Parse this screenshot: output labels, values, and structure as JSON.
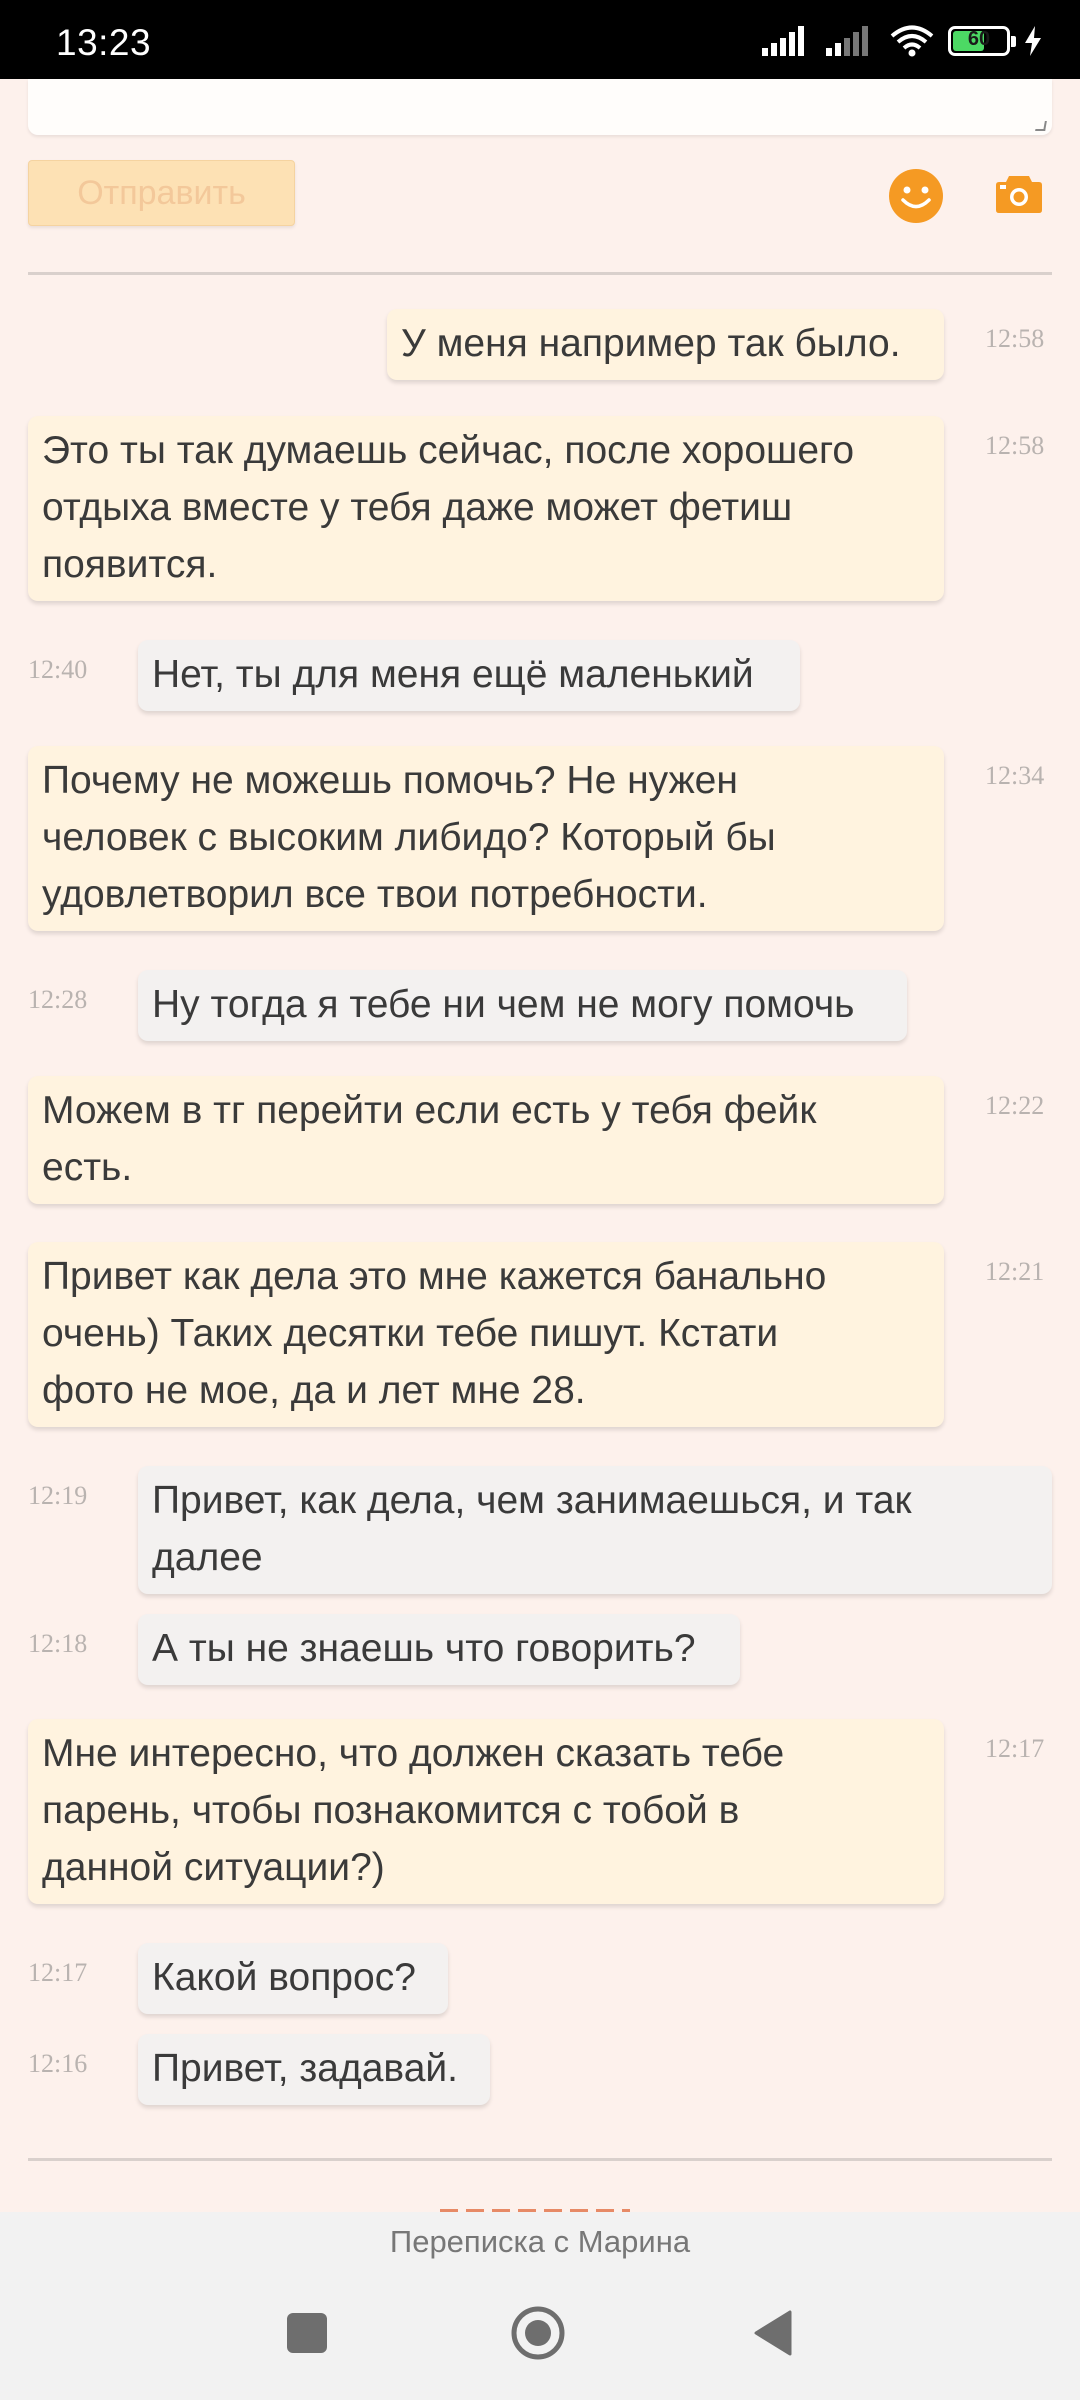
{
  "status_bar": {
    "time": "13:23",
    "battery": "60"
  },
  "compose": {
    "send_label": "Отправить",
    "emoji_icon": "smiley-icon",
    "photo_icon": "camera-icon"
  },
  "messages": [
    {
      "direction": "out",
      "text": "У меня например так было.",
      "time": "12:58"
    },
    {
      "direction": "out",
      "text": "Это ты так думаешь сейчас, после хорошего\nотдыха вместе у тебя даже может фетиш\nпоявится.",
      "time": "12:58"
    },
    {
      "direction": "in",
      "text": "Нет, ты для меня ещё маленький",
      "time": "12:40"
    },
    {
      "direction": "out",
      "text": "Почему не можешь помочь? Не нужен\nчеловек с высоким либидо? Который бы\nудовлетворил все твои потребности.",
      "time": "12:34"
    },
    {
      "direction": "in",
      "text": "Ну тогда я тебе ни чем не могу помочь",
      "time": "12:28"
    },
    {
      "direction": "out",
      "text": "Можем в тг перейти если есть у тебя фейк\nесть.",
      "time": "12:22"
    },
    {
      "direction": "out",
      "text": "Привет как дела это мне кажется банально\nочень) Таких десятки тебе пишут. Кстати\nфото не мое, да и лет мне 28.",
      "time": "12:21"
    },
    {
      "direction": "in",
      "text": "Привет, как дела, чем занимаешься, и так\nдалее",
      "time": "12:19"
    },
    {
      "direction": "in",
      "text": "А ты не знаешь что говорить?",
      "time": "12:18"
    },
    {
      "direction": "out",
      "text": "Мне интересно, что должен сказать тебе\nпарень, чтобы познакомится с тобой в\nданной ситуации?)",
      "time": "12:17"
    },
    {
      "direction": "in",
      "text": "Какой вопрос?",
      "time": "12:17"
    },
    {
      "direction": "in",
      "text": "Привет, задавай.",
      "time": "12:16"
    }
  ],
  "footer": {
    "title": "Переписка с Марина"
  },
  "nav": {
    "recents_icon": "square-icon",
    "home_icon": "circle-icon",
    "back_icon": "triangle-back-icon"
  },
  "colors": {
    "background": "#fdf1ec",
    "sent_bubble": "#fff3df",
    "received_bubble": "#f3f1f0",
    "accent_orange": "#f59a23",
    "send_button": "#fde1b4"
  }
}
